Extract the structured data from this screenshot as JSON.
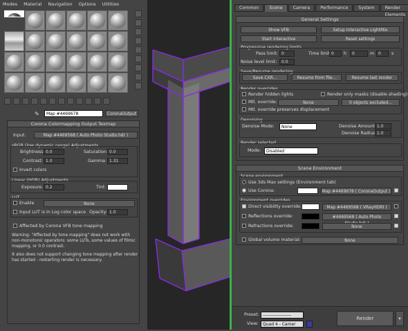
{
  "menu": [
    "Modes",
    "Material",
    "Navigation",
    "Options",
    "Utilities"
  ],
  "material_slot": {
    "name": "Map #4469678",
    "type": "CoronaOutput"
  },
  "colormap": {
    "title": "Corona Colormapping Output Texmap",
    "input_label": "Input:",
    "input_value": "Map #4469568  ( Auto Photo Studio.hdr )",
    "srgb_title": "sRGB (low dynamic range) Adjustments",
    "brightness_label": "Brightness:",
    "brightness": "0.0",
    "saturation_label": "Saturation:",
    "saturation": "0.0",
    "contrast_label": "Contrast:",
    "contrast": "1.0",
    "gamma_label": "Gamma:",
    "gamma": "1.31",
    "invert_label": "Invert colors",
    "linear_title": "Linear (HDR) Adjustments",
    "exposure_label": "Exposure:",
    "exposure": "0.2",
    "tint_label": "Tint:",
    "lut_title": "LUT",
    "enable_label": "Enable",
    "lut_value": "None",
    "lut_log_label": "Input LUT is in Log color space",
    "opacity_label": "Opacity:",
    "opacity": "1.0",
    "affected_label": "Affected by Corona VFB tone mapping",
    "warn1": "Warning: \"Affected by tone mapping\" does not work with",
    "warn2": "non-monotonic operators: some LUTs, some values of filmic",
    "warn3": "mapping, or 0.0 contrast.",
    "warn4": "It also does not support changing tone mapping after render",
    "warn5": "has started - restarting render is necessary."
  },
  "tabs": [
    "Common",
    "Scene",
    "Camera",
    "Performance",
    "System",
    "Render Elements"
  ],
  "general": {
    "title": "General Settings",
    "show_vfb": "Show VFB",
    "setup_lightmix": "Setup Interactive LightMix",
    "start_interactive": "Start interactive",
    "reset_settings": "Reset settings",
    "prog_limits": "Progressive rendering limits",
    "pass_limit_label": "Pass limit:",
    "pass_limit": "0",
    "time_limit_label": "Time limit:",
    "h_value": "0",
    "h": "h",
    "m_value": "0",
    "m": "m",
    "s_value": "0",
    "s": "s",
    "noise_label": "Noise level limit:",
    "noise": "0.0",
    "save_resume": "Save/Resume rendering",
    "save_cxr": "Save CXR...",
    "resume_file": "Resume from file...",
    "resume_last": "Resume last render",
    "overrides_title": "Render overrides",
    "hidden_lights": "Render hidden lights",
    "only_masks": "Render only masks (disable shading)",
    "mtl_override": "Mtl. override:",
    "mtl_none": "None",
    "excluded": "0 objects excluded...",
    "preserve_disp": "Mtl. override preserves displacement",
    "denoise_title": "Denoising",
    "denoise_mode_label": "Denoise Mode:",
    "denoise_mode": "None",
    "denoise_amount_label": "Denoise Amount:",
    "denoise_amount": "1.0",
    "denoise_radius_label": "Denoise Radius:",
    "denoise_radius": "1.0",
    "render_sel_title": "Render selected",
    "mode_label": "Mode:",
    "mode": "Disabled"
  },
  "scene_env": {
    "title": "Scene Environment",
    "scene_env_group": "Scene environment",
    "use_3dsmax": "Use 3ds Max settings (Environment tab)",
    "use_corona": "Use Corona:",
    "corona_map": "Map #4469678  ( CoronaOutput )",
    "env_overrides": "Environment overrides",
    "direct_vis": "Direct visibility override:",
    "direct_map": "Map #4469568  ( VRayHDRI )",
    "reflections": "Reflections override:",
    "refl_map": "#4469568  ( Auto Photo Studio.hdr )",
    "refractions": "Refractions override:",
    "refr_map": "None",
    "global_volume": "Global volume material:",
    "gv_map": "None"
  },
  "bottom": {
    "preset_label": "Preset:",
    "preset": "-------------------",
    "view_label": "View:",
    "view": "Quad 4 - Camer",
    "render": "Render"
  }
}
